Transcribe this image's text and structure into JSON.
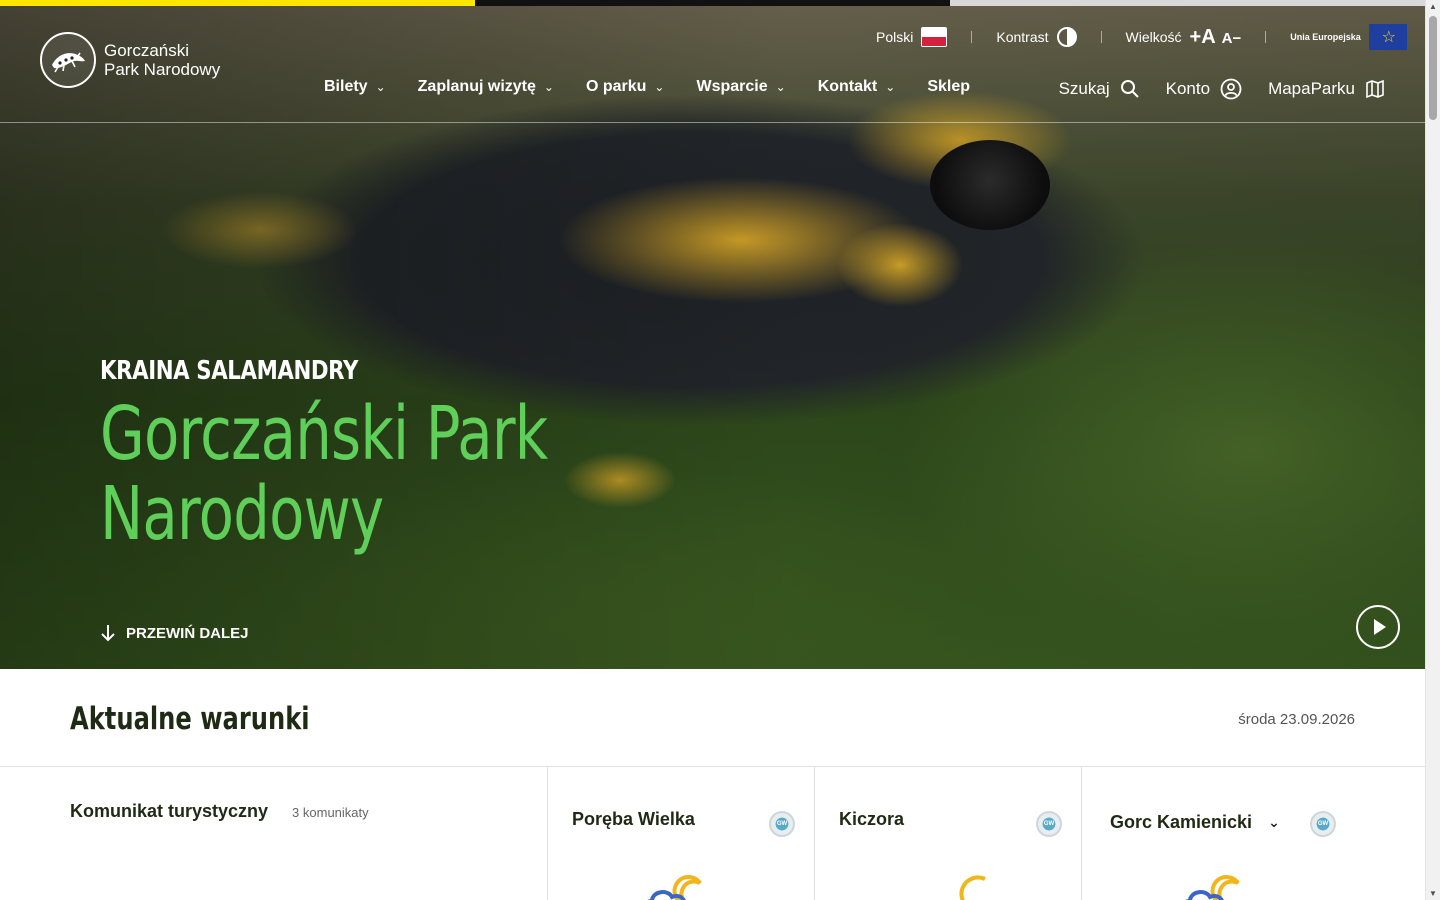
{
  "header": {
    "logo_line1": "Gorczański",
    "logo_line2": "Park Narodowy",
    "utility": {
      "language": "Polski",
      "contrast": "Kontrast",
      "size": "Wielkość",
      "size_increase": "+A",
      "size_decrease": "A−",
      "eu": "Unia Europejska"
    },
    "nav": [
      {
        "label": "Bilety"
      },
      {
        "label": "Zaplanuj wizytę"
      },
      {
        "label": "O parku"
      },
      {
        "label": "Wsparcie"
      },
      {
        "label": "Kontakt"
      },
      {
        "label": "Sklep"
      }
    ],
    "nav_right": {
      "search": "Szukaj",
      "account": "Konto",
      "map": "MapaParku"
    }
  },
  "hero": {
    "kicker": "KRAINA SALAMANDRY",
    "title_line1": "Gorczański Park",
    "title_line2": "Narodowy",
    "scroll_label": "PRZEWIŃ DALEJ"
  },
  "conditions": {
    "title": "Aktualne warunki",
    "date": "środa 23.09.2026",
    "message_title": "Komunikat turystyczny",
    "message_count": "3 komunikaty",
    "stations": [
      {
        "name": "Poręba Wielka",
        "badge": "GW"
      },
      {
        "name": "Kiczora",
        "badge": "GW"
      },
      {
        "name": "Gorc Kamienicki",
        "badge": "GW"
      }
    ]
  },
  "colors": {
    "accent_green": "#5fcf5a",
    "top_bar_yellow": "#ffe600",
    "top_bar_black": "#111111",
    "top_bar_grey": "#d8d8d8",
    "weather_moon": "#f2b51c",
    "weather_cloud": "#3a66c4"
  }
}
